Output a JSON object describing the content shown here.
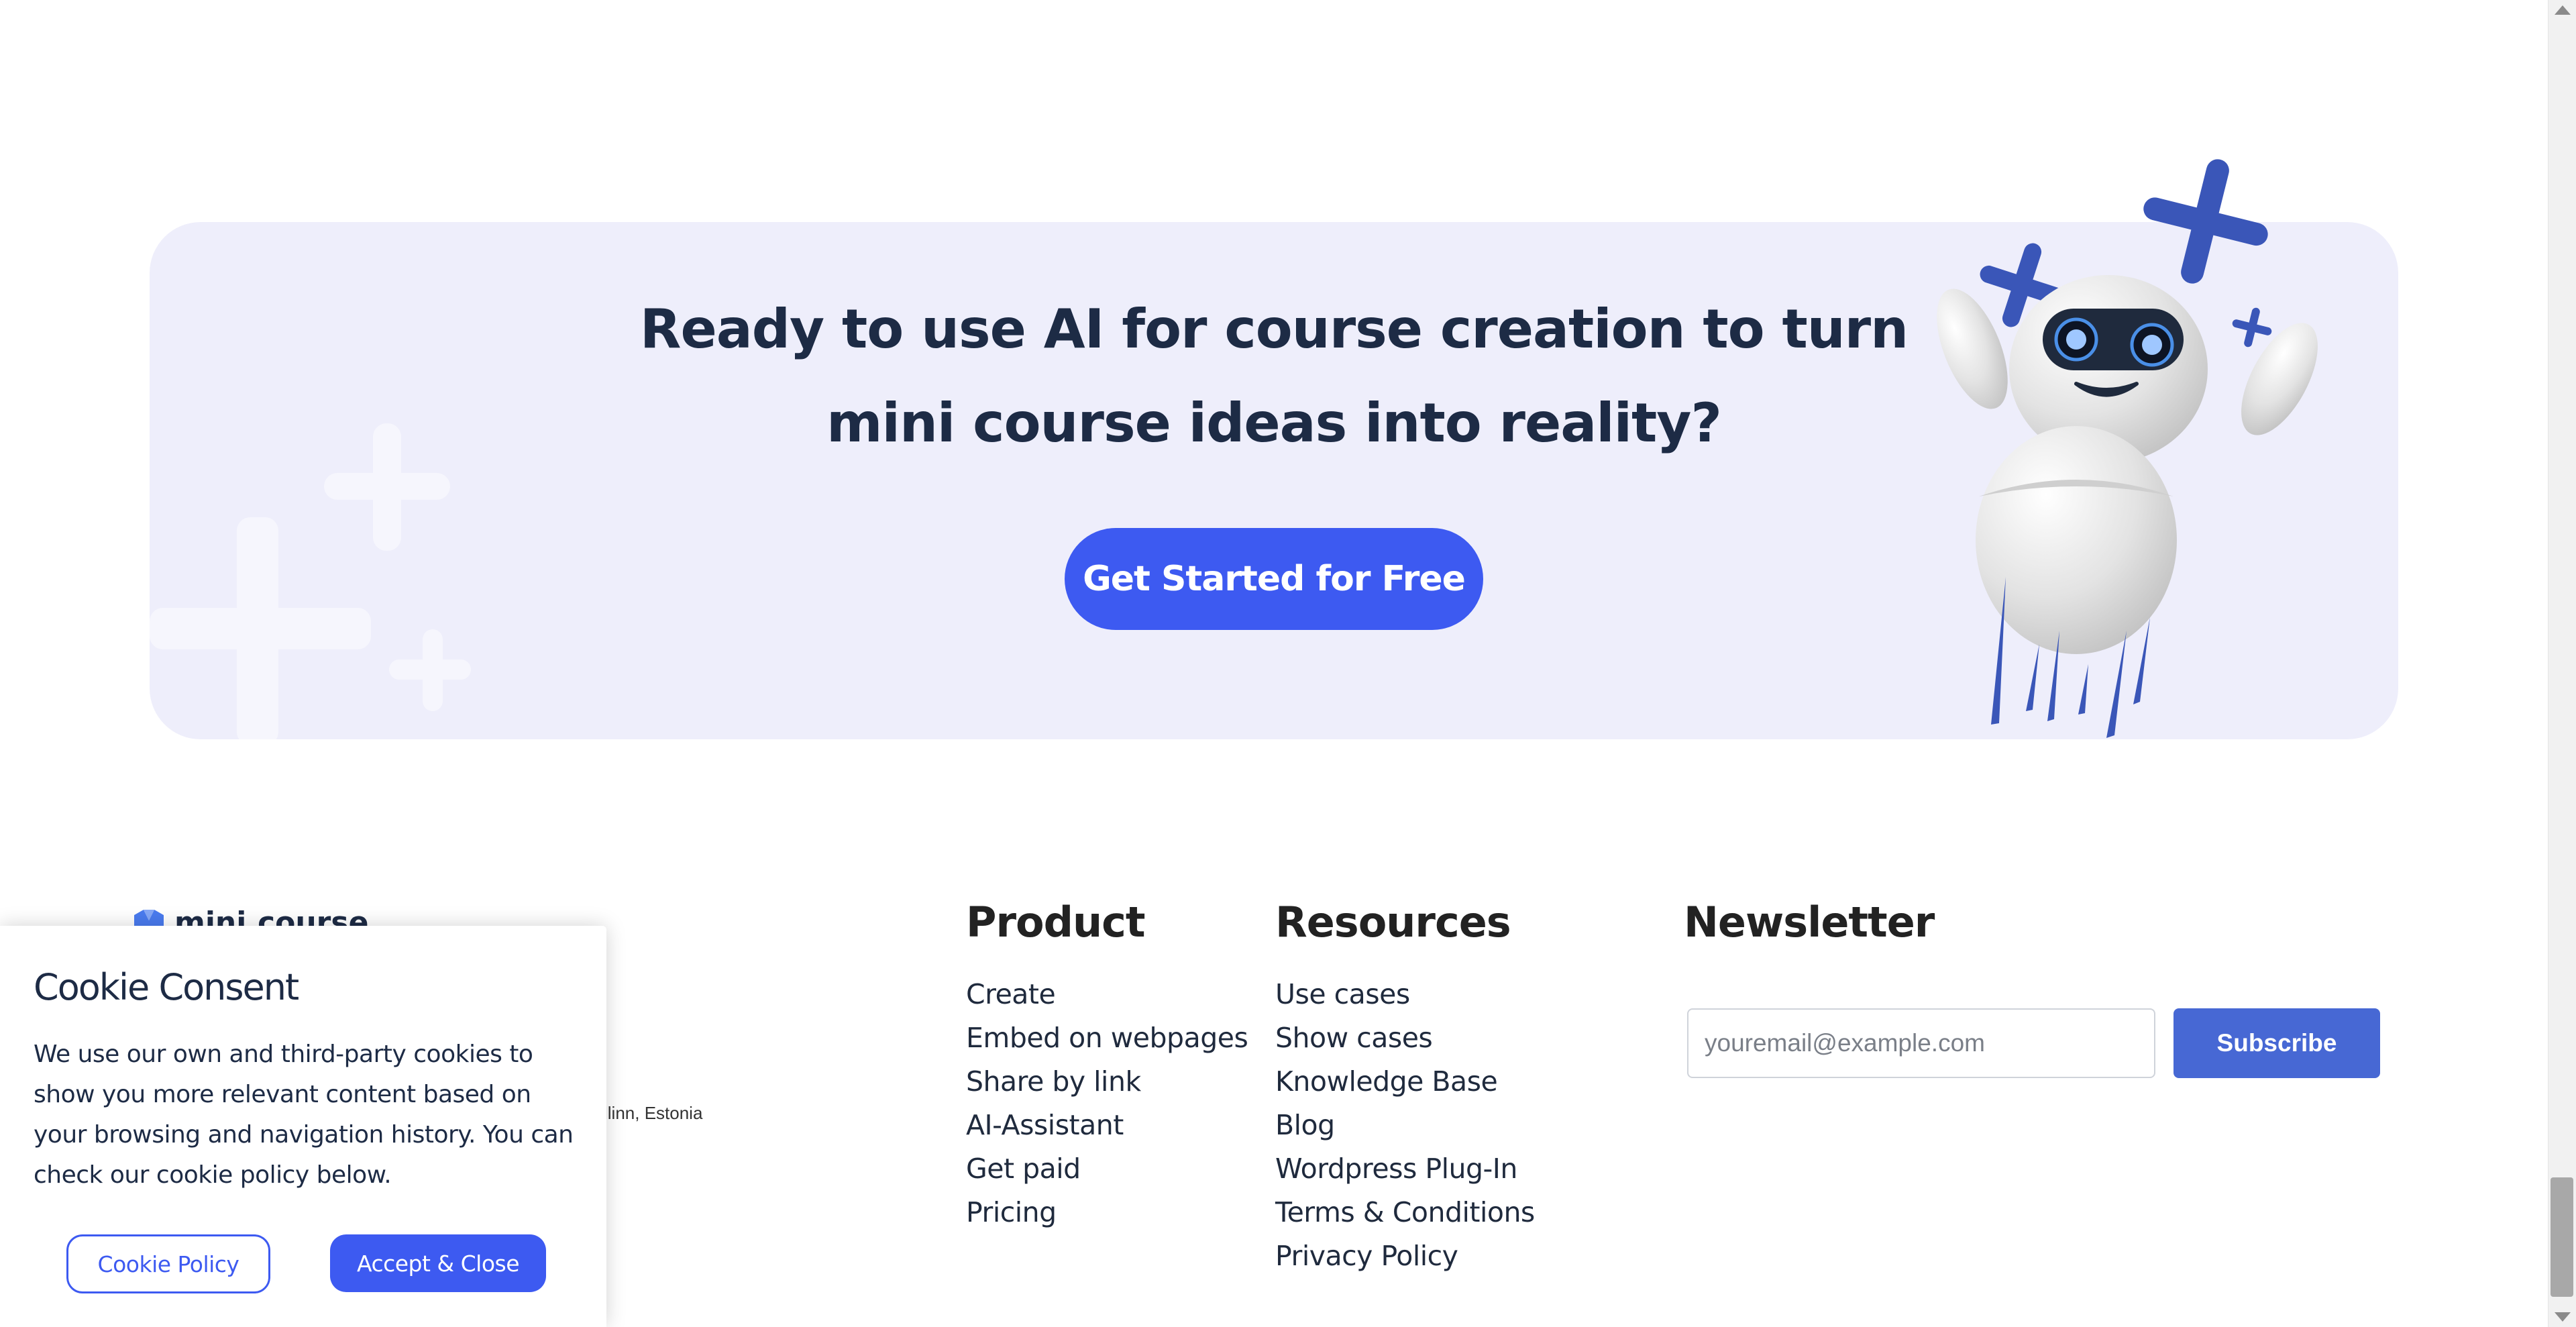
{
  "cta": {
    "title_line1": "Ready to use AI for course creation to turn",
    "title_line2": "mini course ideas into reality?",
    "button_label": "Get Started for Free"
  },
  "footer": {
    "logo_text": "mini.course",
    "address_fragment": "llinn, Estonia",
    "product": {
      "title": "Product",
      "links": [
        "Create",
        "Embed on webpages",
        "Share by link",
        "AI-Assistant",
        "Get paid",
        "Pricing"
      ]
    },
    "resources": {
      "title": "Resources",
      "links": [
        "Use cases",
        "Show cases",
        "Knowledge Base",
        "Blog",
        "Wordpress Plug-In",
        "Terms & Conditions",
        "Privacy Policy"
      ]
    },
    "newsletter": {
      "title": "Newsletter",
      "email_placeholder": "youremail@example.com",
      "subscribe_label": "Subscribe"
    }
  },
  "cookie": {
    "title": "Cookie Consent",
    "text": "We use our own and third-party cookies to show you more relevant content based on your browsing and navigation history. You can check our cookie policy below.",
    "policy_label": "Cookie Policy",
    "accept_label": "Accept & Close"
  },
  "colors": {
    "accent": "#3d5af1",
    "banner_bg": "#eeeefb",
    "subscribe_bg": "#4768d4"
  }
}
